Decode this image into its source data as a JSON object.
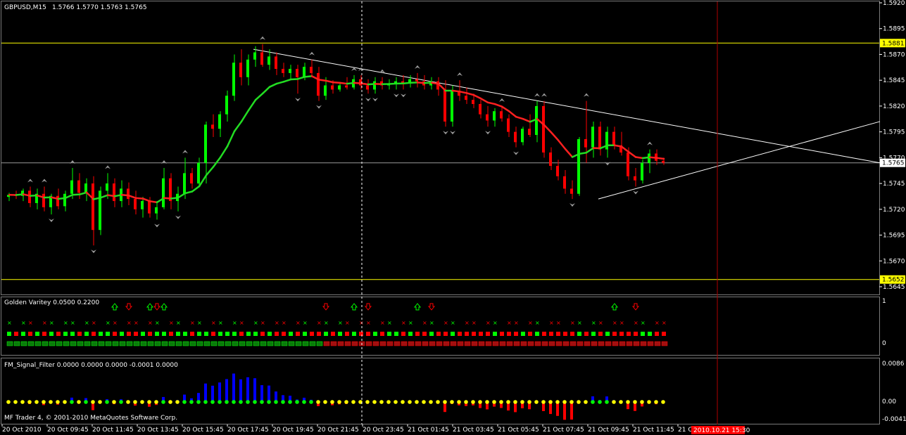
{
  "window": {
    "symbol_label": "GBPUSD,M15",
    "ohlc_text": "1.5766 1.5770 1.5763 1.5765",
    "footer": "MF Trader 4, © 2001-2010 MetaQuotes Software Corp.",
    "time_tag": "2010.10.21 15:30"
  },
  "colors": {
    "background": "#000000",
    "bull": "#00ff00",
    "bear": "#ff0000",
    "ma_up": "#22dd22",
    "ma_down": "#ff2020",
    "level_line": "#ffff00",
    "trendline": "#ffffff",
    "hist_blue": "#0000ff",
    "hist_red": "#ff0000",
    "dot_yellow": "#ffff00",
    "dot_green": "#00ff00",
    "frame": "#808080"
  },
  "price_axis": {
    "ticks": [
      "1.5920",
      "1.5895",
      "1.5870",
      "1.5845",
      "1.5820",
      "1.5795",
      "1.5770",
      "1.5745",
      "1.5720",
      "1.5695",
      "1.5670",
      "1.5645"
    ],
    "range": [
      1.5645,
      1.592
    ],
    "level_high": "1.5881",
    "level_low": "1.5652",
    "current": "1.5765"
  },
  "time_axis": [
    "20 Oct 2010",
    "20 Oct 09:45",
    "20 Oct 11:45",
    "20 Oct 13:45",
    "20 Oct 15:45",
    "20 Oct 17:45",
    "20 Oct 19:45",
    "20 Oct 21:45",
    "20 Oct 23:45",
    "21 Oct 01:45",
    "21 Oct 03:45",
    "21 Oct 05:45",
    "21 Oct 07:45",
    "21 Oct 09:45",
    "21 Oct 11:45",
    "21 C"
  ],
  "indicator1": {
    "title": "Golden Varitey 0.0500 0.2200",
    "axis_top": "1",
    "axis_bottom": "0",
    "up_arrows_at_bars": [
      15,
      20,
      22,
      49,
      58,
      86
    ],
    "down_arrows_at_bars": [
      17,
      21,
      45,
      51,
      60,
      89
    ]
  },
  "indicator2": {
    "title": "FM_Signal_Filter 0.0000 0.0000 0.0000 -0.0001 0.0000",
    "axis_top": "0.0086",
    "axis_mid": "0.00",
    "axis_bottom": "-0.0041",
    "range": [
      -0.0041,
      0.0086
    ]
  },
  "chart_data": {
    "type": "candlestick",
    "symbol": "GBPUSD",
    "timeframe": "M15",
    "ylim": [
      1.5645,
      1.592
    ],
    "candles": [
      [
        1.5732,
        1.5736,
        1.5728,
        1.5734
      ],
      [
        1.5734,
        1.5738,
        1.573,
        1.5733
      ],
      [
        1.5733,
        1.574,
        1.5728,
        1.5738
      ],
      [
        1.5738,
        1.5742,
        1.5722,
        1.5726
      ],
      [
        1.5726,
        1.574,
        1.572,
        1.5735
      ],
      [
        1.5735,
        1.5742,
        1.5718,
        1.5722
      ],
      [
        1.5722,
        1.5735,
        1.5715,
        1.5733
      ],
      [
        1.5733,
        1.574,
        1.572,
        1.5723
      ],
      [
        1.5723,
        1.5738,
        1.5718,
        1.5735
      ],
      [
        1.5735,
        1.576,
        1.573,
        1.5748
      ],
      [
        1.5748,
        1.5755,
        1.573,
        1.5736
      ],
      [
        1.5736,
        1.575,
        1.5728,
        1.5745
      ],
      [
        1.5745,
        1.5752,
        1.5685,
        1.57
      ],
      [
        1.57,
        1.5742,
        1.5695,
        1.5738
      ],
      [
        1.5738,
        1.5755,
        1.573,
        1.5745
      ],
      [
        1.5745,
        1.575,
        1.5722,
        1.5728
      ],
      [
        1.5728,
        1.5748,
        1.5722,
        1.574
      ],
      [
        1.574,
        1.5746,
        1.5724,
        1.573
      ],
      [
        1.573,
        1.5738,
        1.5715,
        1.572
      ],
      [
        1.572,
        1.5732,
        1.5712,
        1.5728
      ],
      [
        1.5728,
        1.5732,
        1.5712,
        1.5716
      ],
      [
        1.5716,
        1.5728,
        1.571,
        1.5722
      ],
      [
        1.5722,
        1.576,
        1.572,
        1.575
      ],
      [
        1.575,
        1.5755,
        1.572,
        1.5728
      ],
      [
        1.5728,
        1.5742,
        1.5718,
        1.5735
      ],
      [
        1.5735,
        1.577,
        1.573,
        1.5755
      ],
      [
        1.5755,
        1.576,
        1.574,
        1.5745
      ],
      [
        1.5745,
        1.577,
        1.5742,
        1.5765
      ],
      [
        1.5765,
        1.5805,
        1.5745,
        1.5802
      ],
      [
        1.5802,
        1.5812,
        1.579,
        1.5798
      ],
      [
        1.5798,
        1.5815,
        1.579,
        1.5812
      ],
      [
        1.5812,
        1.5835,
        1.5805,
        1.583
      ],
      [
        1.583,
        1.587,
        1.5825,
        1.5862
      ],
      [
        1.5862,
        1.5875,
        1.584,
        1.5848
      ],
      [
        1.5848,
        1.587,
        1.584,
        1.5865
      ],
      [
        1.5865,
        1.5878,
        1.5858,
        1.5872
      ],
      [
        1.5872,
        1.588,
        1.5858,
        1.586
      ],
      [
        1.586,
        1.5875,
        1.5855,
        1.5868
      ],
      [
        1.5868,
        1.5872,
        1.585,
        1.5856
      ],
      [
        1.5856,
        1.5862,
        1.5848,
        1.5852
      ],
      [
        1.5852,
        1.586,
        1.5846,
        1.5856
      ],
      [
        1.5856,
        1.586,
        1.5832,
        1.5848
      ],
      [
        1.5848,
        1.5862,
        1.5845,
        1.5858
      ],
      [
        1.5858,
        1.5865,
        1.5848,
        1.5852
      ],
      [
        1.5852,
        1.5858,
        1.5825,
        1.583
      ],
      [
        1.583,
        1.5848,
        1.5826,
        1.584
      ],
      [
        1.584,
        1.5845,
        1.5832,
        1.5836
      ],
      [
        1.5836,
        1.5842,
        1.5834,
        1.584
      ],
      [
        1.584,
        1.5848,
        1.5836,
        1.5838
      ],
      [
        1.5838,
        1.585,
        1.5836,
        1.5846
      ],
      [
        1.5846,
        1.585,
        1.5836,
        1.584
      ],
      [
        1.584,
        1.5846,
        1.5832,
        1.5836
      ],
      [
        1.5836,
        1.5848,
        1.5832,
        1.5844
      ],
      [
        1.5844,
        1.5848,
        1.5836,
        1.584
      ],
      [
        1.584,
        1.5846,
        1.5836,
        1.5842
      ],
      [
        1.5842,
        1.5848,
        1.5836,
        1.5844
      ],
      [
        1.5844,
        1.585,
        1.5836,
        1.5842
      ],
      [
        1.5842,
        1.585,
        1.5838,
        1.5846
      ],
      [
        1.5846,
        1.5852,
        1.5838,
        1.5844
      ],
      [
        1.5844,
        1.585,
        1.5836,
        1.584
      ],
      [
        1.584,
        1.5848,
        1.5836,
        1.5844
      ],
      [
        1.5844,
        1.5848,
        1.583,
        1.5836
      ],
      [
        1.5836,
        1.5845,
        1.58,
        1.5805
      ],
      [
        1.5805,
        1.584,
        1.58,
        1.5835
      ],
      [
        1.5835,
        1.5845,
        1.5825,
        1.583
      ],
      [
        1.583,
        1.5838,
        1.5822,
        1.5826
      ],
      [
        1.5826,
        1.5832,
        1.5818,
        1.5822
      ],
      [
        1.5822,
        1.5826,
        1.5808,
        1.5812
      ],
      [
        1.5812,
        1.582,
        1.58,
        1.5806
      ],
      [
        1.5806,
        1.5818,
        1.58,
        1.5815
      ],
      [
        1.5815,
        1.582,
        1.5805,
        1.5808
      ],
      [
        1.5808,
        1.5812,
        1.579,
        1.5795
      ],
      [
        1.5795,
        1.58,
        1.578,
        1.5785
      ],
      [
        1.5785,
        1.58,
        1.5782,
        1.5798
      ],
      [
        1.5798,
        1.5812,
        1.579,
        1.5792
      ],
      [
        1.5792,
        1.5825,
        1.5785,
        1.582
      ],
      [
        1.582,
        1.5825,
        1.577,
        1.5775
      ],
      [
        1.5775,
        1.578,
        1.5758,
        1.5762
      ],
      [
        1.5762,
        1.5768,
        1.5748,
        1.5752
      ],
      [
        1.5752,
        1.5758,
        1.5735,
        1.574
      ],
      [
        1.574,
        1.5748,
        1.573,
        1.5735
      ],
      [
        1.5735,
        1.579,
        1.5733,
        1.5788
      ],
      [
        1.5788,
        1.5825,
        1.5765,
        1.578
      ],
      [
        1.578,
        1.5805,
        1.577,
        1.58
      ],
      [
        1.58,
        1.5805,
        1.5772,
        1.5778
      ],
      [
        1.5778,
        1.58,
        1.577,
        1.5795
      ],
      [
        1.5795,
        1.58,
        1.5778,
        1.5782
      ],
      [
        1.5782,
        1.5795,
        1.5772,
        1.5775
      ],
      [
        1.5775,
        1.578,
        1.5748,
        1.5752
      ],
      [
        1.5752,
        1.576,
        1.5742,
        1.5748
      ],
      [
        1.5748,
        1.5768,
        1.5745,
        1.5765
      ],
      [
        1.5765,
        1.5778,
        1.5755,
        1.5774
      ],
      [
        1.5774,
        1.5778,
        1.5763,
        1.5767
      ],
      [
        1.5767,
        1.577,
        1.5763,
        1.5765
      ]
    ],
    "level_lines": [
      1.5881,
      1.5652
    ],
    "current_price": 1.5765,
    "trendlines": [
      {
        "from_bar": 35,
        "from_price": 1.5875,
        "to_bar": 120,
        "to_price": 1.5765
      },
      {
        "from_bar": 84,
        "from_price": 1.573,
        "to_bar": 120,
        "to_price": 1.5805
      }
    ],
    "vertical_markers": {
      "dashed_at_bar": 50,
      "red_at_bar": 100
    }
  }
}
